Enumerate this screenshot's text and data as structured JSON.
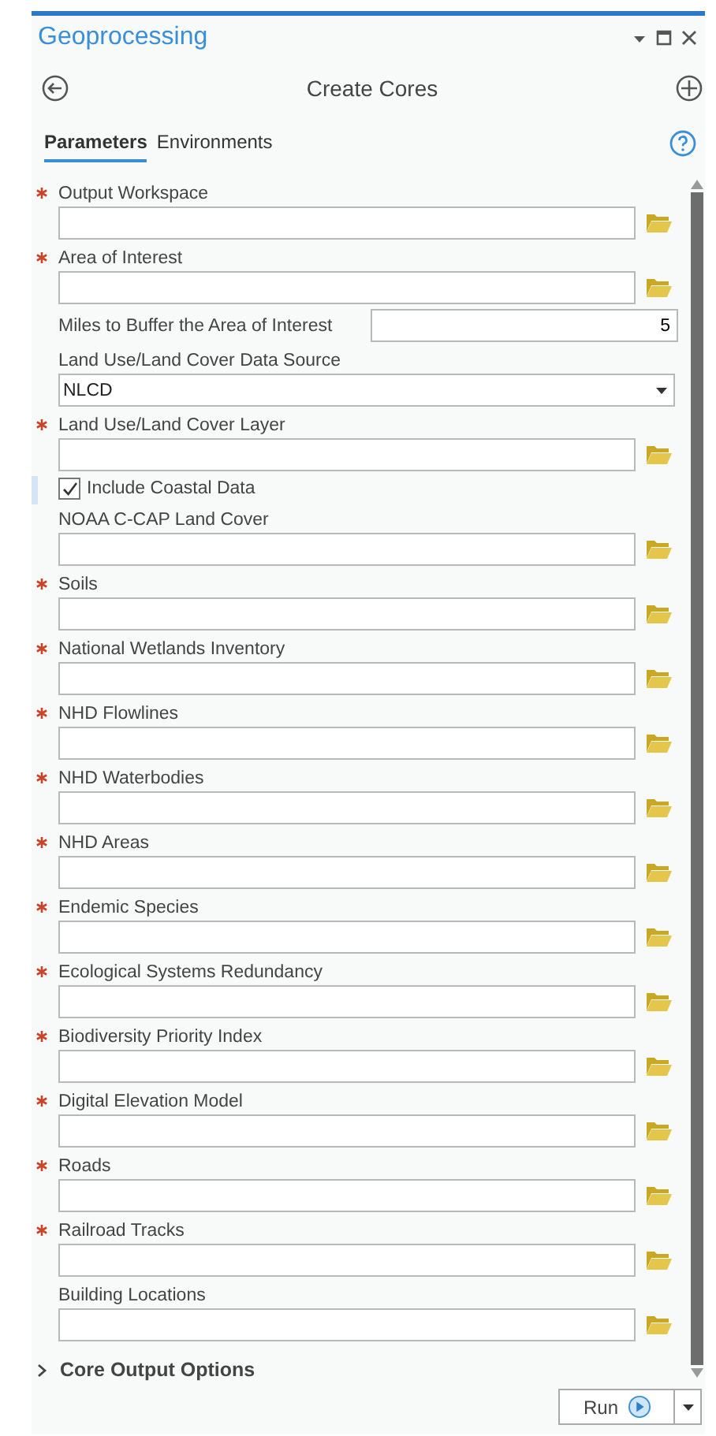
{
  "window": {
    "title": "Geoprocessing"
  },
  "tool": {
    "title": "Create Cores"
  },
  "tabs": [
    {
      "label": "Parameters",
      "selected": true
    },
    {
      "label": "Environments",
      "selected": false
    }
  ],
  "parameters": [
    {
      "kind": "path",
      "label": "Output Workspace",
      "required": true
    },
    {
      "kind": "path",
      "label": "Area of Interest",
      "required": true
    },
    {
      "kind": "number",
      "label": "Miles to Buffer the Area of Interest",
      "required": false,
      "value": "5"
    },
    {
      "kind": "dropdown",
      "label": "Land Use/Land Cover Data Source",
      "required": false,
      "value": "NLCD"
    },
    {
      "kind": "path",
      "label": "Land Use/Land Cover Layer",
      "required": true
    },
    {
      "kind": "checkbox",
      "label": "Include Coastal Data",
      "checked": true
    },
    {
      "kind": "path",
      "label": "NOAA C-CAP Land Cover",
      "required": false
    },
    {
      "kind": "path",
      "label": "Soils",
      "required": true
    },
    {
      "kind": "path",
      "label": "National Wetlands Inventory",
      "required": true
    },
    {
      "kind": "path",
      "label": "NHD Flowlines",
      "required": true
    },
    {
      "kind": "path",
      "label": "NHD Waterbodies",
      "required": true
    },
    {
      "kind": "path",
      "label": "NHD Areas",
      "required": true
    },
    {
      "kind": "path",
      "label": "Endemic Species",
      "required": true
    },
    {
      "kind": "path",
      "label": "Ecological Systems Redundancy",
      "required": true
    },
    {
      "kind": "path",
      "label": "Biodiversity Priority Index",
      "required": true
    },
    {
      "kind": "path",
      "label": "Digital Elevation Model",
      "required": true
    },
    {
      "kind": "path",
      "label": "Roads",
      "required": true
    },
    {
      "kind": "path",
      "label": "Railroad Tracks",
      "required": true
    },
    {
      "kind": "path",
      "label": "Building Locations",
      "required": false
    }
  ],
  "section": {
    "label": "Core Output Options",
    "expanded": false
  },
  "run_button": {
    "label": "Run"
  }
}
